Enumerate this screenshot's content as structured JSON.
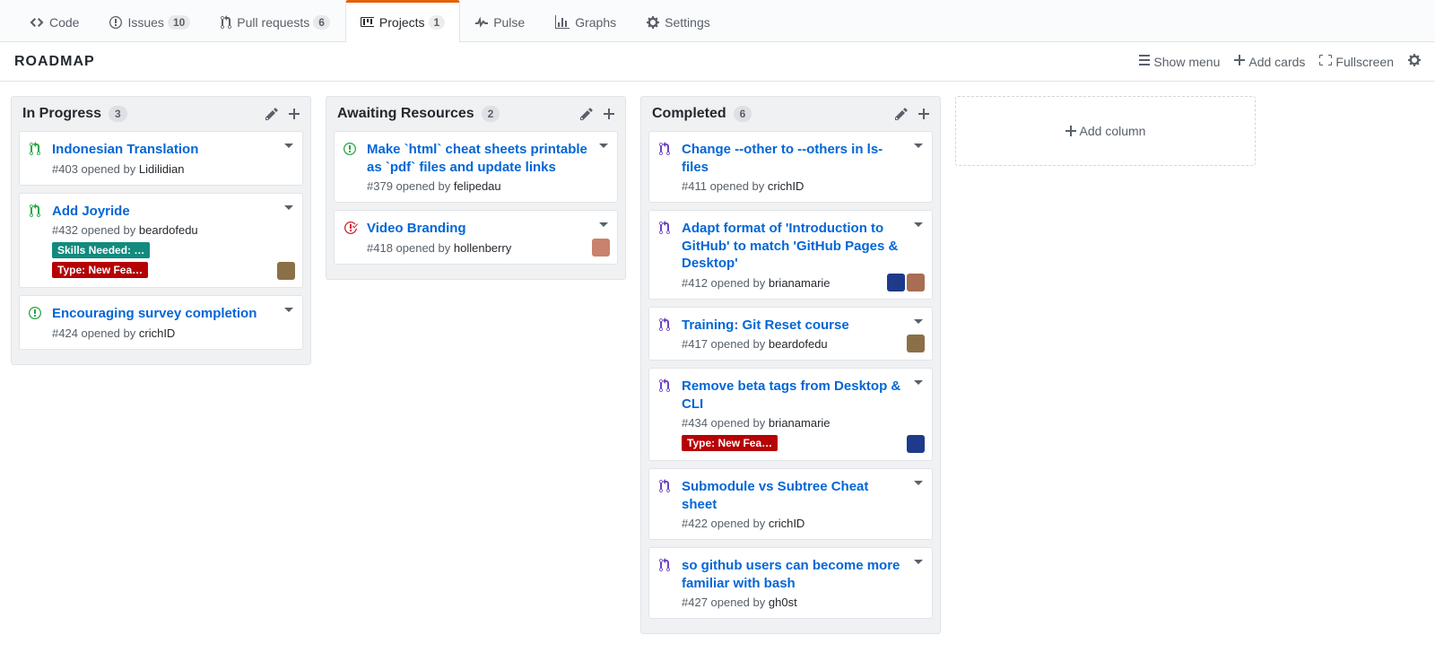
{
  "nav": {
    "code": "Code",
    "issues": "Issues",
    "issues_count": "10",
    "prs": "Pull requests",
    "prs_count": "6",
    "projects": "Projects",
    "projects_count": "1",
    "pulse": "Pulse",
    "graphs": "Graphs",
    "settings": "Settings"
  },
  "project": {
    "title": "ROADMAP",
    "show_menu": "Show menu",
    "add_cards": "Add cards",
    "fullscreen": "Fullscreen"
  },
  "add_column_label": "Add column",
  "columns": [
    {
      "name": "In Progress",
      "count": "3",
      "cards": [
        {
          "icon": "pr-open",
          "title": "Indonesian Translation",
          "number": "#403",
          "author": "Lidilidian",
          "labels": [],
          "avatars": []
        },
        {
          "icon": "pr-open",
          "title": "Add Joyride",
          "number": "#432",
          "author": "beardofedu",
          "labels": [
            {
              "text": "Skills Needed: …",
              "color": "#128a7e"
            },
            {
              "text": "Type: New Fea…",
              "color": "#b60205"
            }
          ],
          "avatars": [
            "#8b6f47"
          ]
        },
        {
          "icon": "issue-open",
          "title": "Encouraging survey completion",
          "number": "#424",
          "author": "crichID",
          "labels": [],
          "avatars": []
        }
      ]
    },
    {
      "name": "Awaiting Resources",
      "count": "2",
      "cards": [
        {
          "icon": "issue-open",
          "title": "Make `html` cheat sheets printable as `pdf` files and update links",
          "number": "#379",
          "author": "felipedau",
          "labels": [],
          "avatars": []
        },
        {
          "icon": "issue-closed",
          "title": "Video Branding",
          "number": "#418",
          "author": "hollenberry",
          "labels": [],
          "avatars": [
            "#c9826b"
          ]
        }
      ]
    },
    {
      "name": "Completed",
      "count": "6",
      "cards": [
        {
          "icon": "pr-merged",
          "title": "Change --other to --others in ls-files",
          "number": "#411",
          "author": "crichID",
          "labels": [],
          "avatars": []
        },
        {
          "icon": "pr-merged",
          "title": "Adapt format of 'Introduction to GitHub' to match 'GitHub Pages & Desktop'",
          "number": "#412",
          "author": "brianamarie",
          "labels": [],
          "avatars": [
            "#1f3a8a",
            "#a86d52"
          ]
        },
        {
          "icon": "pr-merged",
          "title": "Training: Git Reset course",
          "number": "#417",
          "author": "beardofedu",
          "labels": [],
          "avatars": [
            "#8b6f47"
          ]
        },
        {
          "icon": "pr-merged",
          "title": "Remove beta tags from Desktop & CLI",
          "number": "#434",
          "author": "brianamarie",
          "labels": [
            {
              "text": "Type: New Fea…",
              "color": "#b60205"
            }
          ],
          "avatars": [
            "#1f3a8a"
          ]
        },
        {
          "icon": "pr-merged",
          "title": "Submodule vs Subtree Cheat sheet",
          "number": "#422",
          "author": "crichID",
          "labels": [],
          "avatars": []
        },
        {
          "icon": "pr-merged",
          "title": "so github users can become more familiar with bash",
          "number": "#427",
          "author": "gh0st",
          "labels": [],
          "avatars": []
        }
      ]
    }
  ]
}
